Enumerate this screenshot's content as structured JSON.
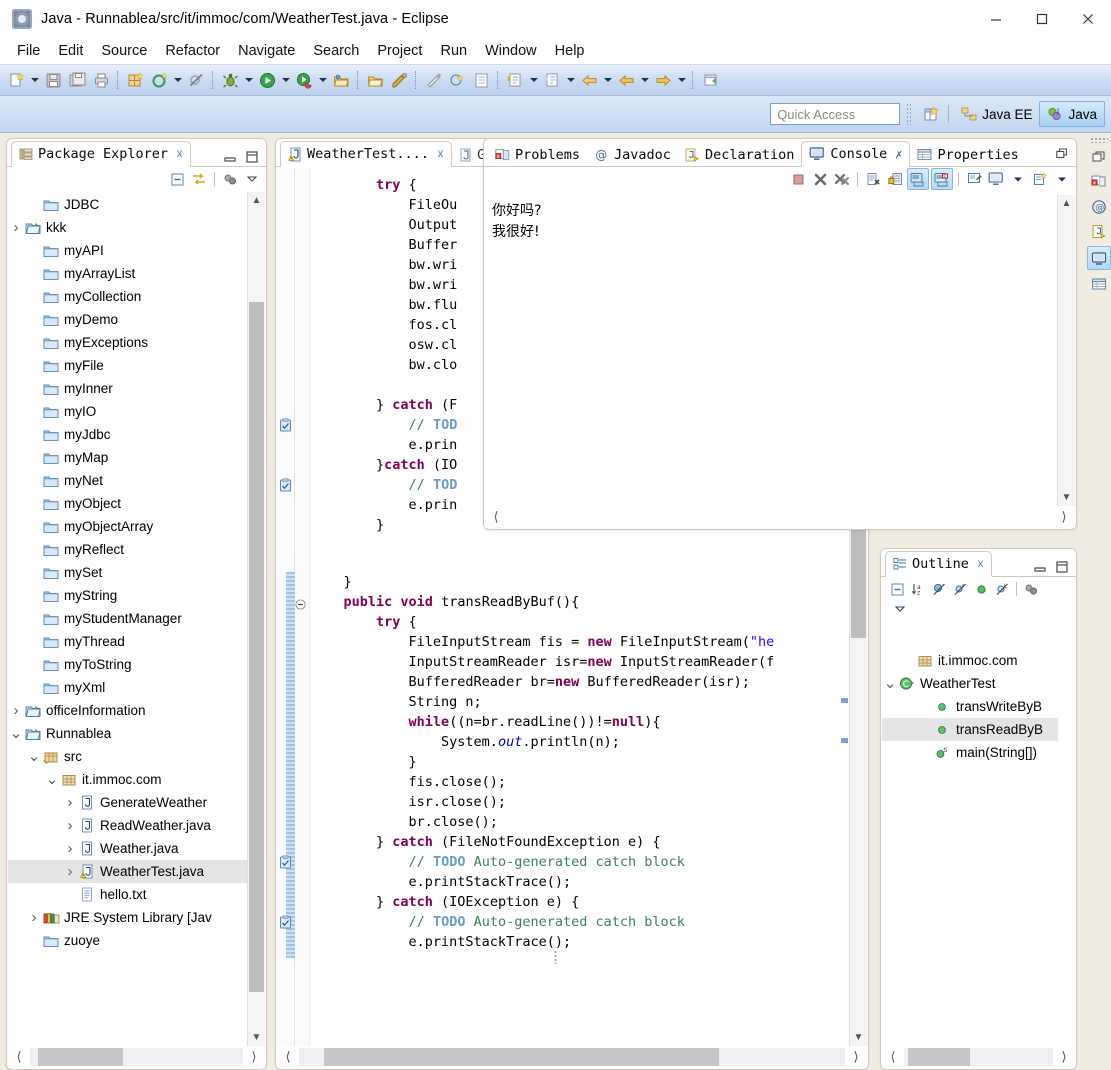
{
  "window": {
    "title": "Java - Runnablea/src/it/immoc/com/WeatherTest.java - Eclipse",
    "app_icon": "eclipse-icon",
    "minimize": "minimize-icon",
    "maximize": "maximize-icon",
    "close": "close-icon"
  },
  "menubar": {
    "items": [
      "File",
      "Edit",
      "Source",
      "Refactor",
      "Navigate",
      "Search",
      "Project",
      "Run",
      "Window",
      "Help"
    ]
  },
  "toolbar": {
    "icons": [
      "new-file-icon",
      "save-icon",
      "save-all-icon",
      "print-icon",
      "new-java-package-icon",
      "build-icon",
      "skip-breakpoints-icon",
      "debug-icon",
      "run-icon",
      "run-external-tools-icon",
      "open-type-icon",
      "open-task-icon",
      "new-annotation-icon",
      "toggle-markoccurrences-icon",
      "coverage-icon",
      "new-class-icon",
      "next-annotation-icon",
      "previous-annotation-icon",
      "last-edit-location-icon",
      "back-icon",
      "forward-icon",
      "pin-editor-icon"
    ]
  },
  "quick_access": {
    "placeholder": "Quick Access",
    "value": "",
    "open-perspective-icon": "open-perspective-icon",
    "perspectives": [
      {
        "label": "Java EE",
        "icon": "java-ee-perspective-icon",
        "active": false
      },
      {
        "label": "Java",
        "icon": "java-perspective-icon",
        "active": true
      }
    ]
  },
  "package_explorer": {
    "tab_label": "Package Explorer",
    "tab_icon": "package-explorer-icon",
    "close_icon": "close-icon",
    "minimize_icon": "minimize-icon",
    "maximize_icon": "maximize-icon",
    "toolbar_icons": [
      "collapse-all-icon",
      "link-with-editor-icon",
      "view-menu-focus-icon",
      "view-menu-icon"
    ],
    "tree": [
      {
        "label": "JDBC",
        "icon": "folder-icon",
        "twist": "",
        "indent": 1,
        "selected": false
      },
      {
        "label": "kkk",
        "icon": "project-icon",
        "twist": ">",
        "indent": 0,
        "selected": false
      },
      {
        "label": "myAPI",
        "icon": "folder-icon",
        "twist": "",
        "indent": 1,
        "selected": false
      },
      {
        "label": "myArrayList",
        "icon": "folder-icon",
        "twist": "",
        "indent": 1,
        "selected": false
      },
      {
        "label": "myCollection",
        "icon": "folder-icon",
        "twist": "",
        "indent": 1,
        "selected": false
      },
      {
        "label": "myDemo",
        "icon": "folder-icon",
        "twist": "",
        "indent": 1,
        "selected": false
      },
      {
        "label": "myExceptions",
        "icon": "folder-icon",
        "twist": "",
        "indent": 1,
        "selected": false
      },
      {
        "label": "myFile",
        "icon": "folder-icon",
        "twist": "",
        "indent": 1,
        "selected": false
      },
      {
        "label": "myInner",
        "icon": "folder-icon",
        "twist": "",
        "indent": 1,
        "selected": false
      },
      {
        "label": "myIO",
        "icon": "folder-icon",
        "twist": "",
        "indent": 1,
        "selected": false
      },
      {
        "label": "myJdbc",
        "icon": "folder-icon",
        "twist": "",
        "indent": 1,
        "selected": false
      },
      {
        "label": "myMap",
        "icon": "folder-icon",
        "twist": "",
        "indent": 1,
        "selected": false
      },
      {
        "label": "myNet",
        "icon": "folder-icon",
        "twist": "",
        "indent": 1,
        "selected": false
      },
      {
        "label": "myObject",
        "icon": "folder-icon",
        "twist": "",
        "indent": 1,
        "selected": false
      },
      {
        "label": "myObjectArray",
        "icon": "folder-icon",
        "twist": "",
        "indent": 1,
        "selected": false
      },
      {
        "label": "myReflect",
        "icon": "folder-icon",
        "twist": "",
        "indent": 1,
        "selected": false
      },
      {
        "label": "mySet",
        "icon": "folder-icon",
        "twist": "",
        "indent": 1,
        "selected": false
      },
      {
        "label": "myString",
        "icon": "folder-icon",
        "twist": "",
        "indent": 1,
        "selected": false
      },
      {
        "label": "myStudentManager",
        "icon": "folder-icon",
        "twist": "",
        "indent": 1,
        "selected": false
      },
      {
        "label": "myThread",
        "icon": "folder-icon",
        "twist": "",
        "indent": 1,
        "selected": false
      },
      {
        "label": "myToString",
        "icon": "folder-icon",
        "twist": "",
        "indent": 1,
        "selected": false
      },
      {
        "label": "myXml",
        "icon": "folder-icon",
        "twist": "",
        "indent": 1,
        "selected": false
      },
      {
        "label": "officeInformation",
        "icon": "project-icon",
        "twist": ">",
        "indent": 0,
        "selected": false
      },
      {
        "label": "Runnablea",
        "icon": "project-icon",
        "twist": "v",
        "indent": 0,
        "selected": false
      },
      {
        "label": "src",
        "icon": "source-folder-icon",
        "twist": "v",
        "indent": 1,
        "selected": false
      },
      {
        "label": "it.immoc.com",
        "icon": "package-icon",
        "twist": "v",
        "indent": 2,
        "selected": false
      },
      {
        "label": "GenerateWeather",
        "icon": "java-file-icon",
        "twist": ">",
        "indent": 3,
        "selected": false
      },
      {
        "label": "ReadWeather.java",
        "icon": "java-file-icon",
        "twist": ">",
        "indent": 3,
        "selected": false
      },
      {
        "label": "Weather.java",
        "icon": "java-file-icon",
        "twist": ">",
        "indent": 3,
        "selected": false
      },
      {
        "label": "WeatherTest.java",
        "icon": "java-file-warning-icon",
        "twist": ">",
        "indent": 3,
        "selected": true
      },
      {
        "label": "hello.txt",
        "icon": "text-file-icon",
        "twist": "",
        "indent": 3,
        "selected": false
      },
      {
        "label": "JRE System Library [Jav",
        "icon": "library-icon",
        "twist": ">",
        "indent": 1,
        "selected": false
      },
      {
        "label": "zuoye",
        "icon": "folder-icon",
        "twist": "",
        "indent": 1,
        "selected": false
      }
    ]
  },
  "editor": {
    "tabs": [
      {
        "label": "WeatherTest....",
        "icon": "java-file-warning-icon",
        "active": true,
        "close_icon": "close-icon"
      },
      {
        "label": "G",
        "icon": "java-file-icon",
        "active": false
      }
    ],
    "code_top": [
      {
        "indent": 8,
        "segments": [
          {
            "t": "try",
            "c": "kw"
          },
          {
            "t": " {",
            "c": ""
          }
        ]
      },
      {
        "indent": 12,
        "segments": [
          {
            "t": "FileOu",
            "c": ""
          }
        ]
      },
      {
        "indent": 12,
        "segments": [
          {
            "t": "Output",
            "c": ""
          }
        ]
      },
      {
        "indent": 12,
        "segments": [
          {
            "t": "Buffer",
            "c": ""
          }
        ]
      },
      {
        "indent": 12,
        "segments": [
          {
            "t": "bw.wri",
            "c": ""
          }
        ]
      },
      {
        "indent": 12,
        "segments": [
          {
            "t": "bw.wri",
            "c": ""
          }
        ]
      },
      {
        "indent": 12,
        "segments": [
          {
            "t": "bw.flu",
            "c": ""
          }
        ]
      },
      {
        "indent": 12,
        "segments": [
          {
            "t": "fos.cl",
            "c": ""
          }
        ]
      },
      {
        "indent": 12,
        "segments": [
          {
            "t": "osw.cl",
            "c": ""
          }
        ]
      },
      {
        "indent": 12,
        "segments": [
          {
            "t": "bw.clo",
            "c": ""
          }
        ]
      },
      {
        "indent": 0,
        "segments": []
      },
      {
        "indent": 8,
        "segments": [
          {
            "t": "} ",
            "c": ""
          },
          {
            "t": "catch",
            "c": "kw"
          },
          {
            "t": " (F",
            "c": ""
          }
        ]
      },
      {
        "indent": 12,
        "segments": [
          {
            "t": "// ",
            "c": "cmt"
          },
          {
            "t": "TOD",
            "c": "todo"
          }
        ],
        "marker": "task-marker-icon"
      },
      {
        "indent": 12,
        "segments": [
          {
            "t": "e.prin",
            "c": ""
          }
        ]
      },
      {
        "indent": 8,
        "segments": [
          {
            "t": "}",
            "c": ""
          },
          {
            "t": "catch",
            "c": "kw"
          },
          {
            "t": " (IO",
            "c": ""
          }
        ]
      },
      {
        "indent": 12,
        "segments": [
          {
            "t": "// ",
            "c": "cmt"
          },
          {
            "t": "TOD",
            "c": "todo"
          }
        ],
        "marker": "task-marker-icon"
      },
      {
        "indent": 12,
        "segments": [
          {
            "t": "e.prin",
            "c": ""
          }
        ]
      },
      {
        "indent": 8,
        "segments": [
          {
            "t": "}",
            "c": ""
          }
        ]
      }
    ],
    "code_bottom": [
      {
        "indent": 4,
        "segments": [
          {
            "t": "}",
            "c": ""
          }
        ]
      },
      {
        "indent": 4,
        "fold": true,
        "segments": [
          {
            "t": "public void ",
            "c": "kw"
          },
          {
            "t": "transReadByBuf(){",
            "c": ""
          }
        ]
      },
      {
        "indent": 8,
        "segments": [
          {
            "t": "try",
            "c": "kw"
          },
          {
            "t": " {",
            "c": ""
          }
        ]
      },
      {
        "indent": 12,
        "segments": [
          {
            "t": "FileInputStream fis = ",
            "c": ""
          },
          {
            "t": "new",
            "c": "kw"
          },
          {
            "t": " FileInputStream(",
            "c": ""
          },
          {
            "t": "\"he",
            "c": "str"
          }
        ]
      },
      {
        "indent": 12,
        "segments": [
          {
            "t": "InputStreamReader isr=",
            "c": ""
          },
          {
            "t": "new",
            "c": "kw"
          },
          {
            "t": " InputStreamReader(f",
            "c": ""
          }
        ]
      },
      {
        "indent": 12,
        "segments": [
          {
            "t": "BufferedReader br=",
            "c": ""
          },
          {
            "t": "new",
            "c": "kw"
          },
          {
            "t": " BufferedReader(isr);",
            "c": ""
          }
        ]
      },
      {
        "indent": 12,
        "segments": [
          {
            "t": "String n;",
            "c": ""
          }
        ]
      },
      {
        "indent": 12,
        "segments": [
          {
            "t": "while",
            "c": "kw"
          },
          {
            "t": "((n=br.readLine())!=",
            "c": ""
          },
          {
            "t": "null",
            "c": "kw"
          },
          {
            "t": "){",
            "c": ""
          }
        ]
      },
      {
        "indent": 16,
        "segments": [
          {
            "t": "System.",
            "c": ""
          },
          {
            "t": "out",
            "c": "fld"
          },
          {
            "t": ".println(n);",
            "c": ""
          }
        ]
      },
      {
        "indent": 12,
        "segments": [
          {
            "t": "}",
            "c": ""
          }
        ]
      },
      {
        "indent": 12,
        "segments": [
          {
            "t": "fis.close();",
            "c": ""
          }
        ]
      },
      {
        "indent": 12,
        "segments": [
          {
            "t": "isr.close();",
            "c": ""
          }
        ]
      },
      {
        "indent": 12,
        "segments": [
          {
            "t": "br.close();",
            "c": ""
          }
        ]
      },
      {
        "indent": 8,
        "segments": [
          {
            "t": "} ",
            "c": ""
          },
          {
            "t": "catch",
            "c": "kw"
          },
          {
            "t": " (FileNotFoundException e) {",
            "c": ""
          }
        ]
      },
      {
        "indent": 12,
        "segments": [
          {
            "t": "// ",
            "c": "cmt"
          },
          {
            "t": "TODO",
            "c": "todo"
          },
          {
            "t": " Auto-generated catch block",
            "c": "cmt"
          }
        ],
        "marker": "task-marker-icon"
      },
      {
        "indent": 12,
        "segments": [
          {
            "t": "e.printStackTrace();",
            "c": ""
          }
        ]
      },
      {
        "indent": 8,
        "segments": [
          {
            "t": "} ",
            "c": ""
          },
          {
            "t": "catch",
            "c": "kw"
          },
          {
            "t": " (IOException e) {",
            "c": ""
          }
        ]
      },
      {
        "indent": 12,
        "segments": [
          {
            "t": "// ",
            "c": "cmt"
          },
          {
            "t": "TODO",
            "c": "todo"
          },
          {
            "t": " Auto-generated catch block",
            "c": "cmt"
          }
        ],
        "marker": "task-marker-icon"
      },
      {
        "indent": 12,
        "segments": [
          {
            "t": "e.printStackTrace();",
            "c": ""
          }
        ]
      }
    ]
  },
  "console_panel": {
    "tabs": [
      {
        "label": "Problems",
        "icon": "problems-icon",
        "active": false
      },
      {
        "label": "Javadoc",
        "icon": "javadoc-icon",
        "active": false
      },
      {
        "label": "Declaration",
        "icon": "declaration-icon",
        "active": false
      },
      {
        "label": "Console",
        "icon": "console-icon",
        "active": true,
        "close_icon": "close-icon"
      },
      {
        "label": "Properties",
        "icon": "properties-icon",
        "active": false
      }
    ],
    "restore_icon": "restore-icon",
    "toolbar_icons": [
      "terminate-icon",
      "remove-launch-icon",
      "remove-all-terminated-icon",
      "clear-console-icon",
      "scroll-lock-icon",
      "word-wrap-icon",
      "show-console-on-output-icon",
      "pin-console-icon",
      "display-selected-console-icon",
      "display-selected-console-menu-icon",
      "open-console-icon",
      "view-menu-icon"
    ],
    "output": "你好吗?\n我很好!"
  },
  "outline": {
    "tab_label": "Outline",
    "tab_icon": "outline-icon",
    "close_icon": "close-icon",
    "minimize_icon": "minimize-icon",
    "maximize_icon": "maximize-icon",
    "toolbar_icons": [
      "collapse-all-icon",
      "sort-icon",
      "hide-fields-icon",
      "hide-static-icon",
      "hide-nonpublic-icon",
      "hide-local-types-icon",
      "view-menu-icon"
    ],
    "tree": [
      {
        "label": "it.immoc.com",
        "icon": "package-icon",
        "twist": "",
        "indent": 1,
        "selected": false
      },
      {
        "label": "WeatherTest",
        "icon": "class-icon",
        "twist": "v",
        "indent": 0,
        "selected": false
      },
      {
        "label": "transWriteByB",
        "icon": "public-method-icon",
        "twist": "",
        "indent": 2,
        "selected": false
      },
      {
        "label": "transReadByB",
        "icon": "public-method-icon",
        "twist": "",
        "indent": 2,
        "selected": true
      },
      {
        "label": "main(String[])",
        "icon": "public-static-method-icon",
        "twist": "",
        "indent": 2,
        "selected": false
      }
    ]
  },
  "fastview": {
    "icons": [
      "restore-icon",
      "problems-icon",
      "javadoc-icon",
      "declaration-icon",
      "console-icon",
      "properties-icon"
    ],
    "selected": "console-icon"
  },
  "statusbar": {
    "grip": "resize-grip-icon"
  },
  "colors": {
    "accent": "#3b6ea5",
    "toolbar_top": "#e9f0fa",
    "toolbar_bottom": "#bdd2ef",
    "workbench_bg": "#f0ece1",
    "selection": "#e4e4e4",
    "keyword": "#7f0055",
    "comment": "#3f7f5f",
    "string": "#2a00ff",
    "todo": "#6a9cc7"
  }
}
